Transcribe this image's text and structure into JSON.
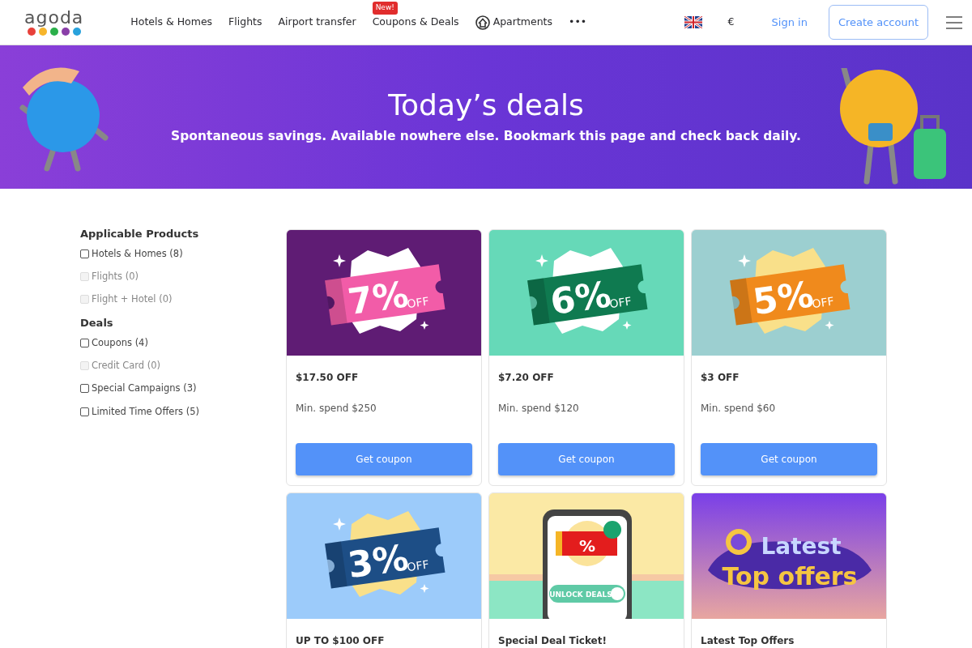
{
  "header": {
    "logo": "agoda",
    "nav": [
      {
        "label": "Hotels & Homes",
        "kind": "text"
      },
      {
        "label": "Flights",
        "kind": "text"
      },
      {
        "label": "Airport transfer",
        "kind": "text"
      },
      {
        "label": "Coupons & Deals",
        "kind": "text",
        "badge": "New!"
      },
      {
        "label": "Apartments",
        "kind": "icon"
      },
      {
        "label": "•••",
        "kind": "text"
      }
    ],
    "currency": "€",
    "sign_in": "Sign in",
    "create_account": "Create account"
  },
  "banner": {
    "title": "Today’s deals",
    "subtitle": "Spontaneous savings. Available nowhere else. Bookmark this page and check back daily."
  },
  "filters": [
    {
      "heading": "Applicable Products",
      "options": [
        {
          "label": "Hotels & Homes (8)",
          "checked": false,
          "disabled": false
        },
        {
          "label": "Flights (0)",
          "checked": false,
          "disabled": true
        },
        {
          "label": "Flight + Hotel (0)",
          "checked": false,
          "disabled": true
        }
      ]
    },
    {
      "heading": "Deals",
      "options": [
        {
          "label": "Coupons (4)",
          "checked": false,
          "disabled": false
        },
        {
          "label": "Credit Card (0)",
          "checked": false,
          "disabled": true
        },
        {
          "label": "Special Campaigns (3)",
          "checked": false,
          "disabled": false
        },
        {
          "label": "Limited Time Offers (5)",
          "checked": false,
          "disabled": false
        }
      ]
    }
  ],
  "deals": [
    {
      "image": {
        "kind": "ticket",
        "big": "7%",
        "small": "OFF",
        "color": "#f25ca8"
      },
      "title": "$17.50 OFF",
      "min_spend": "Min. spend $250",
      "button": "Get coupon"
    },
    {
      "image": {
        "kind": "ticket",
        "big": "6%",
        "small": "OFF",
        "color": "#0f7a50"
      },
      "title": "$7.20 OFF",
      "min_spend": "Min. spend $120",
      "button": "Get coupon"
    },
    {
      "image": {
        "kind": "ticket",
        "big": "5%",
        "small": "OFF",
        "color": "#f08a1c"
      },
      "title": "$3 OFF",
      "min_spend": "Min. spend $60",
      "button": "Get coupon"
    },
    {
      "image": {
        "kind": "ticket",
        "big": "3%",
        "small": "OFF",
        "color": "#1d4e86"
      },
      "title": "UP TO $100 OFF"
    },
    {
      "image": {
        "kind": "phone",
        "big": "%",
        "small": "UNLOCK DEALS"
      },
      "title": "Special Deal Ticket!"
    },
    {
      "image": {
        "kind": "banner",
        "big": "Latest",
        "small": "Top offers"
      },
      "title": "Latest Top Offers"
    }
  ]
}
